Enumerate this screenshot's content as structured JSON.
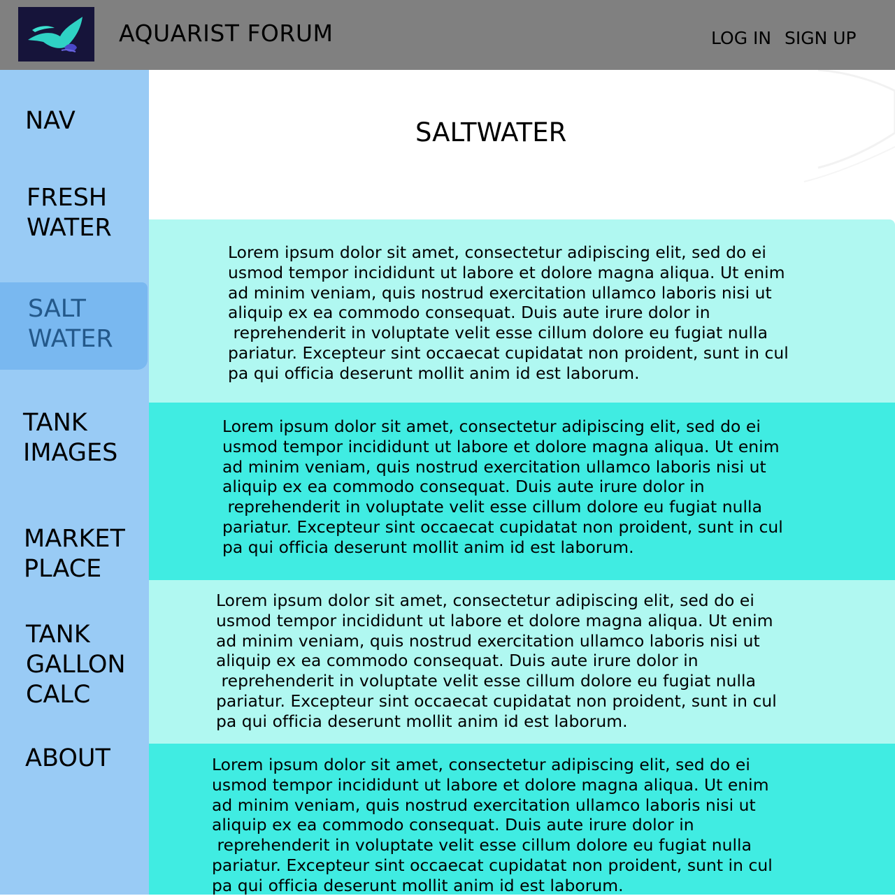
{
  "header": {
    "logo_icon": "manta-ray-icon",
    "site_title": "AQUARIST FORUM",
    "login_label": "LOG IN",
    "signup_label": "SIGN UP"
  },
  "sidebar": {
    "title": "NAV",
    "items": [
      {
        "label": "FRESH\nWATER",
        "active": false
      },
      {
        "label": "SALT\nWATER",
        "active": true
      },
      {
        "label": "TANK\nIMAGES",
        "active": false
      },
      {
        "label": "MARKET\nPLACE",
        "active": false
      },
      {
        "label": "TANK\nGALLON\nCALC",
        "active": false
      },
      {
        "label": "ABOUT",
        "active": false
      }
    ]
  },
  "main": {
    "heading": "SALTWATER",
    "posts": [
      {
        "text": "Lorem ipsum dolor sit amet, consectetur adipiscing elit, sed do ei\nusmod tempor incididunt ut labore et dolore magna aliqua. Ut enim\nad minim veniam, quis nostrud exercitation ullamco laboris nisi ut\naliquip ex ea commodo consequat. Duis aute irure dolor in\n reprehenderit in voluptate velit esse cillum dolore eu fugiat nulla\npariatur. Excepteur sint occaecat cupidatat non proident, sunt in cul\npa qui officia deserunt mollit anim id est laborum."
      },
      {
        "text": "Lorem ipsum dolor sit amet, consectetur adipiscing elit, sed do ei\nusmod tempor incididunt ut labore et dolore magna aliqua. Ut enim\nad minim veniam, quis nostrud exercitation ullamco laboris nisi ut\naliquip ex ea commodo consequat. Duis aute irure dolor in\n reprehenderit in voluptate velit esse cillum dolore eu fugiat nulla\npariatur. Excepteur sint occaecat cupidatat non proident, sunt in cul\npa qui officia deserunt mollit anim id est laborum."
      },
      {
        "text": "Lorem ipsum dolor sit amet, consectetur adipiscing elit, sed do ei\nusmod tempor incididunt ut labore et dolore magna aliqua. Ut enim\nad minim veniam, quis nostrud exercitation ullamco laboris nisi ut\naliquip ex ea commodo consequat. Duis aute irure dolor in\n reprehenderit in voluptate velit esse cillum dolore eu fugiat nulla\npariatur. Excepteur sint occaecat cupidatat non proident, sunt in cul\npa qui officia deserunt mollit anim id est laborum."
      },
      {
        "text": "Lorem ipsum dolor sit amet, consectetur adipiscing elit, sed do ei\nusmod tempor incididunt ut labore et dolore magna aliqua. Ut enim\nad minim veniam, quis nostrud exercitation ullamco laboris nisi ut\naliquip ex ea commodo consequat. Duis aute irure dolor in\n reprehenderit in voluptate velit esse cillum dolore eu fugiat nulla\npariatur. Excepteur sint occaecat cupidatat non proident, sunt in cul\npa qui officia deserunt mollit anim id est laborum."
      }
    ]
  },
  "colors": {
    "header_bg": "#808080",
    "sidebar_bg": "#99cbf5",
    "sidebar_active_bg": "#79b8f0",
    "sidebar_active_text": "#23588a",
    "post_light": "#b0f8f1",
    "post_dark": "#40ece2",
    "logo_bg": "#16143a"
  }
}
